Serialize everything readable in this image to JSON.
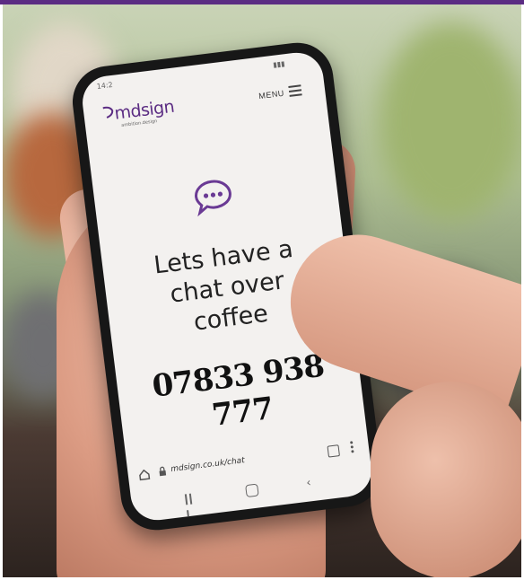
{
  "brand": {
    "name": "mdsign",
    "tagline": "ambition.design"
  },
  "header": {
    "menu_label": "MENU"
  },
  "main": {
    "headline": "Lets have a chat over coffee",
    "phone_number": "07833 938 777"
  },
  "browser": {
    "url": "mdsign.co.uk/chat"
  },
  "colors": {
    "brand_purple": "#5b2c83",
    "screen_bg": "#f3f1ef"
  },
  "icons": [
    "chat-bubble-icon",
    "hamburger-icon",
    "home-icon",
    "lock-icon",
    "tabs-icon",
    "more-icon",
    "recent-apps-icon",
    "nav-home-icon",
    "back-icon"
  ]
}
